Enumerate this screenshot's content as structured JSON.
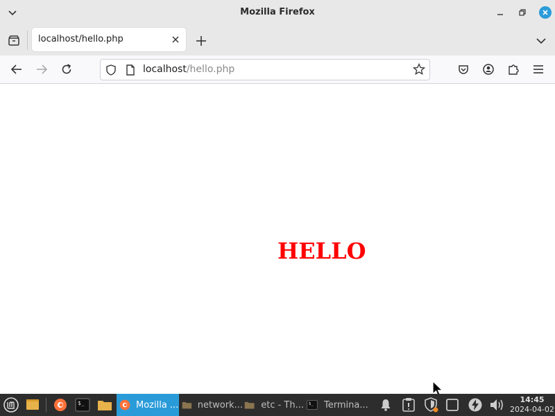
{
  "window": {
    "title": "Mozilla Firefox"
  },
  "tabs": [
    {
      "label": "localhost/hello.php",
      "active": true
    }
  ],
  "urlbar": {
    "host": "localhost",
    "path": "/hello.php"
  },
  "page": {
    "heading": "HELLO",
    "heading_color": "#ff0000"
  },
  "taskbar": {
    "items": [
      {
        "label": "Mozilla ...",
        "icon": "firefox-icon",
        "active": true
      },
      {
        "label": "network...",
        "icon": "folder-icon",
        "active": false
      },
      {
        "label": "etc - Th...",
        "icon": "folder-icon",
        "active": false
      },
      {
        "label": "Termina...",
        "icon": "terminal-icon",
        "active": false
      }
    ],
    "clock": {
      "time": "14:45",
      "date": "2024-04-02"
    },
    "accent_color": "#2a9bd9"
  }
}
